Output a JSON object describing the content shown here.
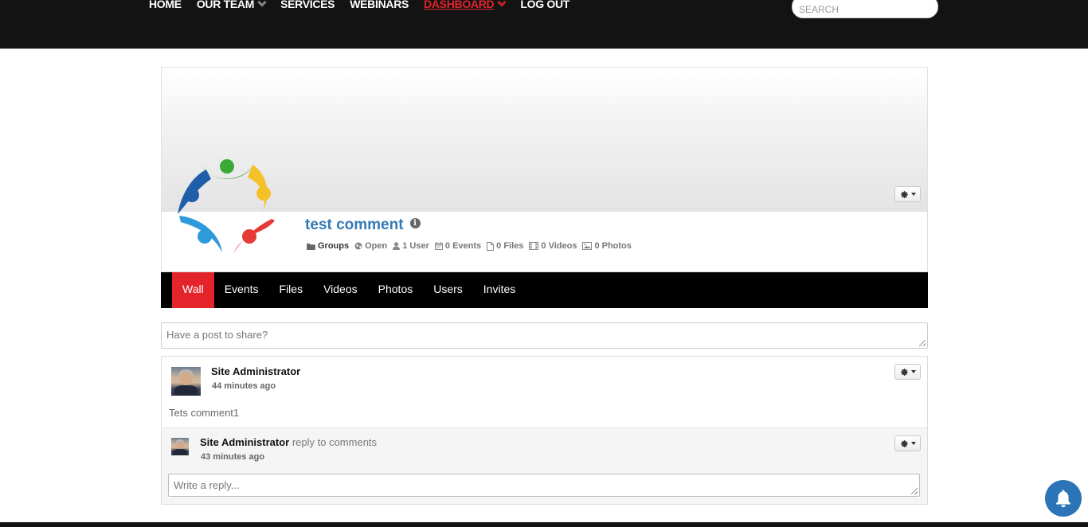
{
  "nav": {
    "items": [
      {
        "label": "HOME",
        "dropdown": false,
        "active": false
      },
      {
        "label": "OUR TEAM",
        "dropdown": true,
        "active": false
      },
      {
        "label": "SERVICES",
        "dropdown": false,
        "active": false
      },
      {
        "label": "WEBINARS",
        "dropdown": false,
        "active": false
      },
      {
        "label": "DASHBOARD",
        "dropdown": true,
        "active": true
      },
      {
        "label": "LOG OUT",
        "dropdown": false,
        "active": false
      }
    ],
    "search_placeholder": "SEARCH"
  },
  "group": {
    "title": "test comment",
    "stats": {
      "type": "Groups",
      "privacy": "Open",
      "users": "1 User",
      "events": "0 Events",
      "files": "0 Files",
      "videos": "0 Videos",
      "photos": "0 Photos"
    }
  },
  "tabs": [
    {
      "label": "Wall",
      "active": true
    },
    {
      "label": "Events",
      "active": false
    },
    {
      "label": "Files",
      "active": false
    },
    {
      "label": "Videos",
      "active": false
    },
    {
      "label": "Photos",
      "active": false
    },
    {
      "label": "Users",
      "active": false
    },
    {
      "label": "Invites",
      "active": false
    }
  ],
  "composer": {
    "placeholder": "Have a post to share?"
  },
  "post": {
    "author": "Site Administrator",
    "time": "44 minutes ago",
    "text": "Tets comment1",
    "reply": {
      "author": "Site Administrator",
      "action": "reply to comments",
      "time": "43 minutes ago"
    },
    "reply_placeholder": "Write a reply..."
  },
  "colors": {
    "accent": "#e3242b",
    "link": "#337ab7",
    "bell": "#2b74b8",
    "topbar": "#131313"
  }
}
